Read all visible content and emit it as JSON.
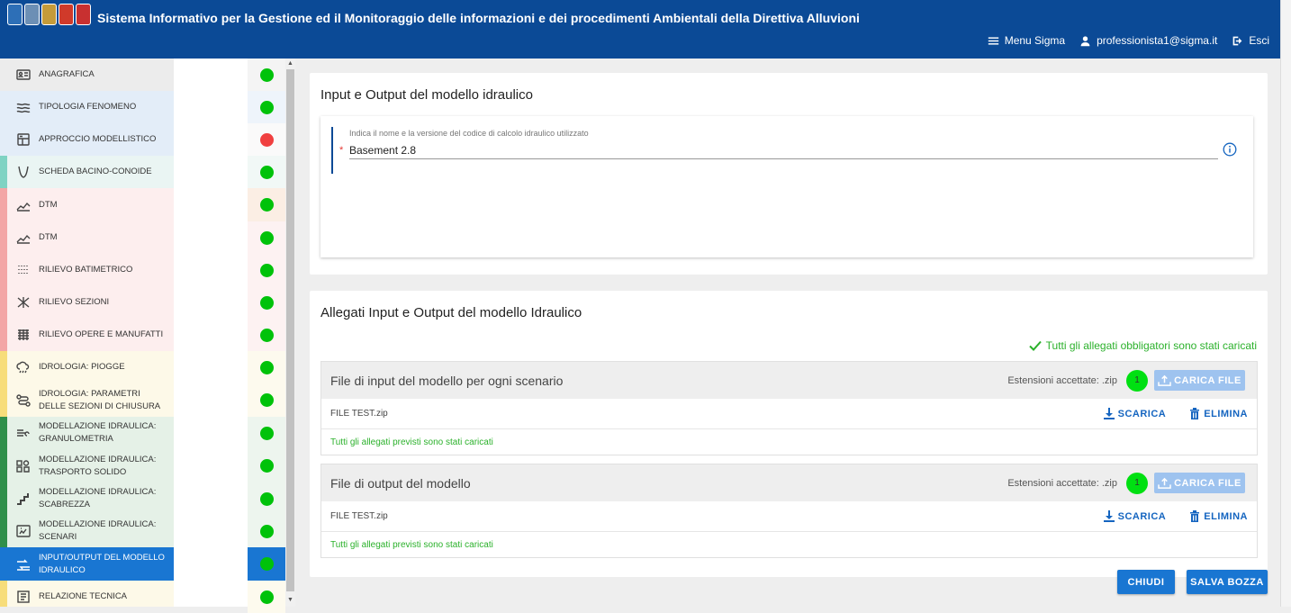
{
  "header": {
    "title": "Sistema Informativo per la Gestione ed il Monitoraggio delle informazioni e dei procedimenti Ambientali della Direttiva Alluvioni",
    "logo_colors": [
      "#2d6fb7",
      "#6c8fb5",
      "#c59b3a",
      "#d03a2a",
      "#c83030"
    ],
    "menu_label": "Menu Sigma",
    "user_label": "professionista1@sigma.it",
    "logout_label": "Esci"
  },
  "sidebar": {
    "items": [
      {
        "label": "ANAGRAFICA",
        "icon": "id-card-icon",
        "bg": "#ececec",
        "accent": "#ececec",
        "status": "green",
        "status_bg": "#f4f4f4"
      },
      {
        "label": "TIPOLOGIA FENOMENO",
        "icon": "waves-icon",
        "bg": "#e3edf8",
        "accent": "#e3edf8",
        "status": "green",
        "status_bg": "#eef4fb"
      },
      {
        "label": "APPROCCIO MODELLISTICO",
        "icon": "dashboard-icon",
        "bg": "#e3edf8",
        "accent": "#e3edf8",
        "status": "red",
        "status_bg": "#fafafa"
      },
      {
        "label": "SCHEDA BACINO-CONOIDE",
        "icon": "valley-icon",
        "bg": "#eaf5f3",
        "accent": "#7fd3c3",
        "status": "green",
        "status_bg": "#f1f8f6"
      },
      {
        "label": "DTM",
        "icon": "terrain-icon",
        "bg": "#fdeeee",
        "accent": "#f3a6a6",
        "status": "green",
        "status_bg": "#fbeee4"
      },
      {
        "label": "DTM",
        "icon": "terrain-icon",
        "bg": "#fdeeee",
        "accent": "#f3a6a6",
        "status": "green",
        "status_bg": "#fdf2f2"
      },
      {
        "label": "RILIEVO BATIMETRICO",
        "icon": "dots-grid-icon",
        "bg": "#fdeeee",
        "accent": "#f3a6a6",
        "status": "green",
        "status_bg": "#fdf2f2"
      },
      {
        "label": "RILIEVO SEZIONI",
        "icon": "sections-icon",
        "bg": "#fdeeee",
        "accent": "#f3a6a6",
        "status": "green",
        "status_bg": "#fdf2f2"
      },
      {
        "label": "RILIEVO OPERE E MANUFATTI",
        "icon": "list-grid-icon",
        "bg": "#fdeeee",
        "accent": "#f3a6a6",
        "status": "green",
        "status_bg": "#fdf2f2"
      },
      {
        "label": "IDROLOGIA: PIOGGE",
        "icon": "rain-cloud-icon",
        "bg": "#fdf9e8",
        "accent": "#f7dd7a",
        "status": "green",
        "status_bg": "#fdfaee"
      },
      {
        "label": "IDROLOGIA: PARAMETRI DELLE SEZIONI DI CHIUSURA",
        "icon": "route-icon",
        "bg": "#fdf9e8",
        "accent": "#f7dd7a",
        "status": "green",
        "status_bg": "#fdfaee"
      },
      {
        "label": "MODELLAZIONE IDRAULICA: GRANULOMETRIA",
        "icon": "grain-icon",
        "bg": "#e5f1e7",
        "accent": "#2f8f4a",
        "status": "green",
        "status_bg": "#edf5ee"
      },
      {
        "label": "MODELLAZIONE IDRAULICA: TRASPORTO SOLIDO",
        "icon": "shapes-icon",
        "bg": "#e5f1e7",
        "accent": "#2f8f4a",
        "status": "green",
        "status_bg": "#edf5ee"
      },
      {
        "label": "MODELLAZIONE IDRAULICA: SCABREZZA",
        "icon": "stairs-icon",
        "bg": "#e5f1e7",
        "accent": "#2f8f4a",
        "status": "green",
        "status_bg": "#edf5ee"
      },
      {
        "label": "MODELLAZIONE IDRAULICA: SCENARI",
        "icon": "scenario-icon",
        "bg": "#e5f1e7",
        "accent": "#2f8f4a",
        "status": "green",
        "status_bg": "#edf5ee"
      },
      {
        "label": "INPUT/OUTPUT DEL MODELLO IDRAULICO",
        "icon": "input-output-icon",
        "bg": "#1976d2",
        "accent": "#1976d2",
        "status": "green",
        "status_bg": "#1976d2",
        "active": true
      },
      {
        "label": "RELAZIONE TECNICA",
        "icon": "report-icon",
        "bg": "#fdf9e8",
        "accent": "#f7dd7a",
        "status": "green",
        "status_bg": "#fdfaee"
      }
    ]
  },
  "card1": {
    "title": "Input e Output del modello idraulico",
    "field_label": "Indica il nome e la versione del codice di calcolo idraulico utilizzato",
    "field_value": "Basement 2.8",
    "required_mark": "*"
  },
  "card2": {
    "title": "Allegati Input e Output del modello Idraulico",
    "all_ok_text": "Tutti gli allegati obbligatori sono stati caricati",
    "sections": [
      {
        "title": "File di input del modello per ogni scenario",
        "extensions": "Estensioni accettate: .zip",
        "count": "1",
        "upload_label": "Carica file",
        "file_name": "FILE TEST.zip",
        "download_label": "Scarica",
        "delete_label": "Elimina",
        "status_text": "Tutti gli allegati previsti sono stati caricati"
      },
      {
        "title": "File di output del modello",
        "extensions": "Estensioni accettate: .zip",
        "count": "1",
        "upload_label": "Carica file",
        "file_name": "FILE TEST.zip",
        "download_label": "Scarica",
        "delete_label": "Elimina",
        "status_text": "Tutti gli allegati previsti sono stati caricati"
      }
    ]
  },
  "footer": {
    "close_label": "Chiudi",
    "save_label": "Salva bozza"
  }
}
